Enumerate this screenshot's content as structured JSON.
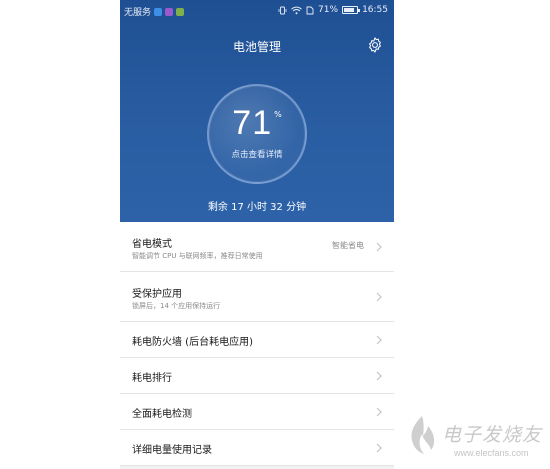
{
  "status_bar": {
    "carrier": "无服务",
    "battery_percent": "71%",
    "time": "16:55",
    "icons": [
      "vibrate-icon",
      "wifi-icon",
      "sim-icon",
      "battery-icon"
    ]
  },
  "header": {
    "title": "电池管理",
    "settings_icon": "gear-icon"
  },
  "gauge": {
    "level": "71",
    "unit": "%",
    "level_fraction": 0.71,
    "detail_link": "点击查看详情"
  },
  "remaining": "剩余 17 小时 32 分钟",
  "menu": [
    {
      "title": "省电模式",
      "subtitle": "智能调节 CPU 与联网频率，推荐日常使用",
      "value": "智能省电"
    },
    {
      "title": "受保护应用",
      "subtitle": "锁屏后，14 个应用保持运行",
      "value": ""
    },
    {
      "title": "耗电防火墙 (后台耗电应用)",
      "subtitle": "",
      "value": ""
    },
    {
      "title": "耗电排行",
      "subtitle": "",
      "value": ""
    },
    {
      "title": "全面耗电检测",
      "subtitle": "",
      "value": ""
    },
    {
      "title": "详细电量使用记录",
      "subtitle": "",
      "value": ""
    }
  ],
  "watermark": {
    "name": "电子发烧友",
    "url": "www.elecfans.com"
  },
  "colors": {
    "hero_blue": "#2a5ea3",
    "list_bg": "#ffffff",
    "chevron": "#c4c4c4"
  }
}
